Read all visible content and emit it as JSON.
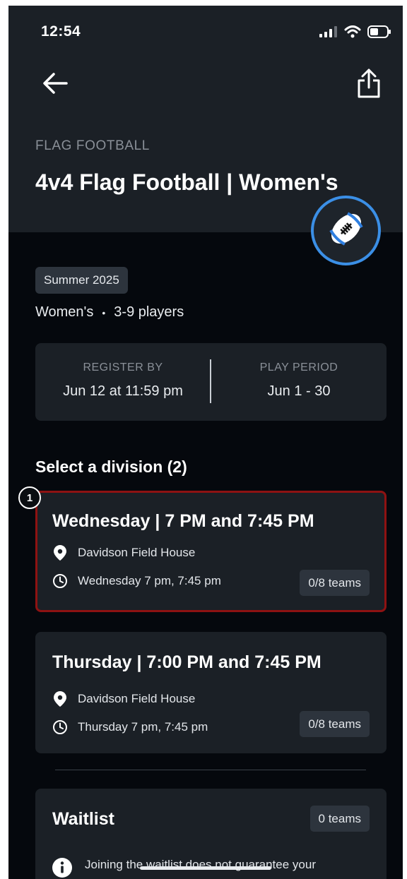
{
  "status_bar": {
    "time": "12:54"
  },
  "header": {
    "category": "FLAG FOOTBALL",
    "title": "4v4 Flag Football | Women's"
  },
  "icons": {
    "back": "arrow-left-icon",
    "share": "share-icon",
    "sport": "football-icon",
    "location": "location-pin-icon",
    "time": "clock-icon",
    "info": "info-icon"
  },
  "event": {
    "season": "Summer 2025",
    "gender": "Women's",
    "separator": "•",
    "players": "3-9 players"
  },
  "dates": {
    "register_label": "REGISTER BY",
    "register_value": "Jun 12 at 11:59 pm",
    "play_label": "PLAY PERIOD",
    "play_value": "Jun 1 - 30"
  },
  "divisions_section": {
    "title": "Select a division (2)"
  },
  "step_marker": "1",
  "divisions": [
    {
      "title": "Wednesday | 7 PM and 7:45 PM",
      "location": "Davidson Field House",
      "schedule": "Wednesday 7 pm, 7:45 pm",
      "teams": "0/8 teams",
      "selected": true
    },
    {
      "title": "Thursday | 7:00 PM and 7:45 PM",
      "location": "Davidson Field House",
      "schedule": "Thursday 7 pm, 7:45 pm",
      "teams": "0/8 teams",
      "selected": false
    }
  ],
  "waitlist": {
    "title": "Waitlist",
    "teams": "0 teams",
    "note": "Joining the waitlist does not guarantee your"
  },
  "colors": {
    "background": "#05080d",
    "card": "#1b2026",
    "chip": "#2d343d",
    "selected_border": "#8e1212",
    "accent_ring": "#3b8fe6"
  }
}
